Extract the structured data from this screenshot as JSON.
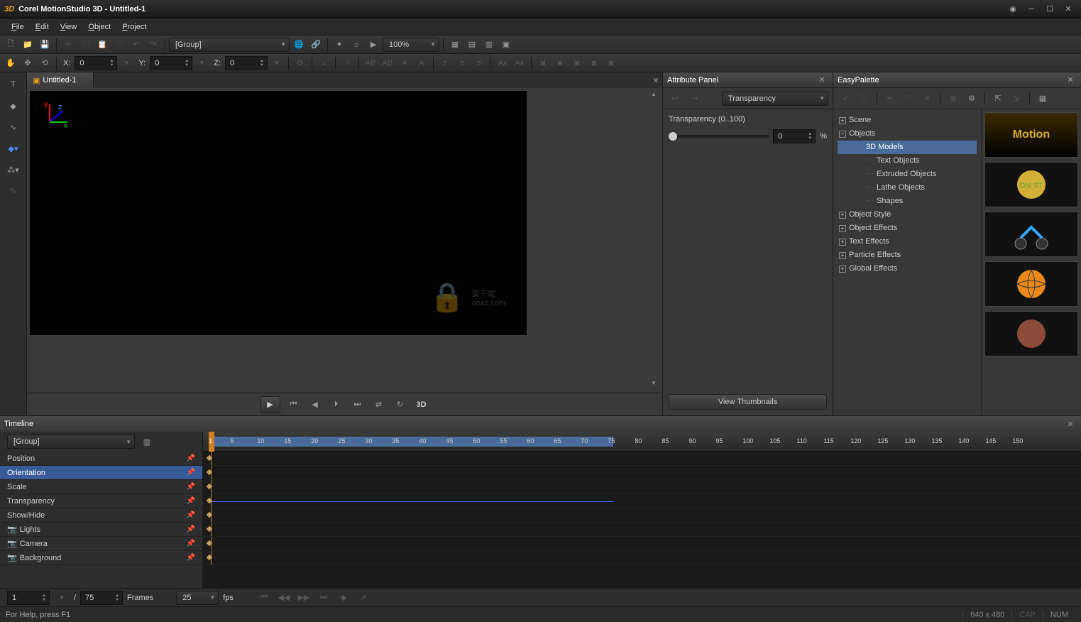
{
  "title": "Corel MotionStudio 3D - Untitled-1",
  "logo": "3D",
  "menu": [
    "File",
    "Edit",
    "View",
    "Object",
    "Project"
  ],
  "toolbar1": {
    "group_combo": "[Group]",
    "zoom": "100%"
  },
  "coords": {
    "x_label": "X:",
    "x": "0",
    "y_label": "Y:",
    "y": "0",
    "z_label": "Z:",
    "z": "0"
  },
  "viewport": {
    "tab": "Untitled-1",
    "axes": [
      "y",
      "z",
      "x"
    ],
    "stereo": "3D"
  },
  "attribute": {
    "title": "Attribute Panel",
    "combo": "Transparency",
    "label": "Transparency (0..100)",
    "value": "0",
    "suffix": "%",
    "view_thumbs": "View Thumbnails"
  },
  "easypalette": {
    "title": "EasyPalette",
    "tree": {
      "scene": "Scene",
      "objects": "Objects",
      "objects_children": [
        "3D Models",
        "Text Objects",
        "Extruded Objects",
        "Lathe Objects",
        "Shapes"
      ],
      "object_style": "Object Style",
      "object_effects": "Object Effects",
      "text_effects": "Text Effects",
      "particle_effects": "Particle Effects",
      "global_effects": "Global Effects"
    }
  },
  "timeline": {
    "title": "Timeline",
    "combo": "[Group]",
    "tracks": [
      "Position",
      "Orientation",
      "Scale",
      "Transparency",
      "Show/Hide",
      "Lights",
      "Camera",
      "Background"
    ],
    "selected_track": "Orientation",
    "ruler_start": 1,
    "ruler_ticks": [
      5,
      10,
      15,
      20,
      25,
      30,
      35,
      40,
      45,
      50,
      55,
      60,
      65,
      70,
      75,
      80,
      85,
      90,
      95,
      100,
      105,
      110,
      115,
      120,
      125,
      130,
      135,
      140,
      145,
      150
    ],
    "footer": {
      "cur": "1",
      "slash": "/",
      "total": "75",
      "unit": "Frames",
      "fps_val": "25",
      "fps_lbl": "fps"
    }
  },
  "status": {
    "help": "For Help, press F1",
    "res": "640 x 480",
    "cap": "CAP",
    "num": "NUM"
  }
}
